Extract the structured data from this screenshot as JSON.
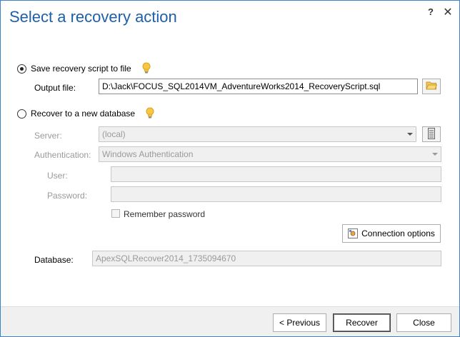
{
  "dialog": {
    "title": "Select a recovery action",
    "help": "?",
    "close": "✕"
  },
  "save_option": {
    "label": "Save recovery script to file",
    "output_file_label": "Output file:",
    "output_file_value": "D:\\Jack\\FOCUS_SQL2014VM_AdventureWorks2014_RecoveryScript.sql"
  },
  "new_db_option": {
    "label": "Recover to a new database",
    "server_label": "Server:",
    "server_value": "(local)",
    "auth_label": "Authentication:",
    "auth_value": "Windows Authentication",
    "user_label": "User:",
    "user_value": "",
    "password_label": "Password:",
    "password_value": "",
    "remember_label": "Remember password",
    "connection_options_label": "Connection options"
  },
  "database": {
    "label": "Database:",
    "value": "ApexSQLRecover2014_1735094670"
  },
  "footer": {
    "previous_label": "< Previous",
    "recover_label": "Recover",
    "close_label": "Close"
  },
  "colors": {
    "title": "#1e5fa8",
    "border": "#3c83c8",
    "footer_bg": "#f0f0f0",
    "disabled_text": "#9a9a9a"
  }
}
